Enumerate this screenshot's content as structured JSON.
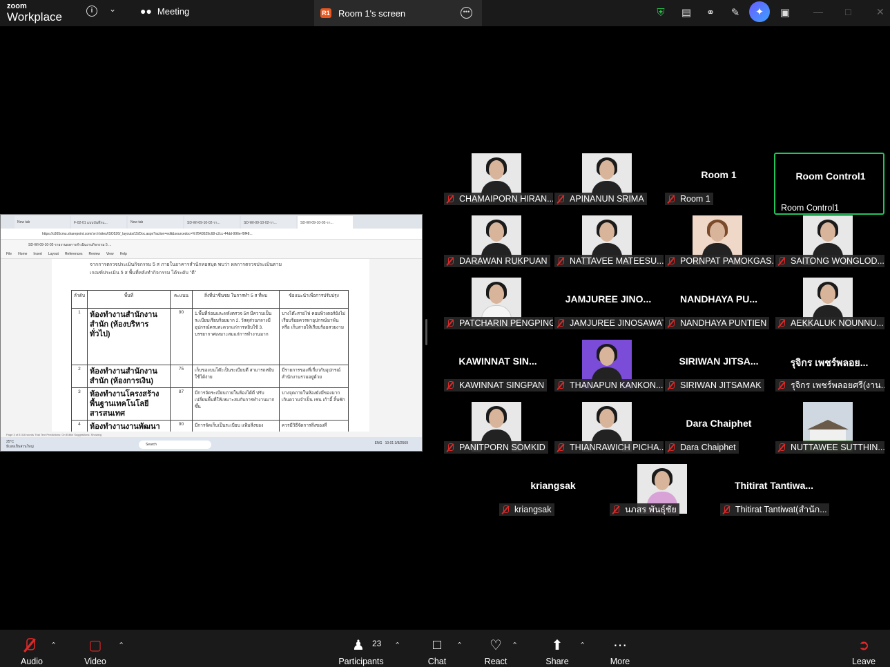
{
  "topbar": {
    "logo_small": "zoom",
    "logo_large": "Workplace",
    "meeting_label": "Meeting",
    "share_badge": "R1",
    "share_tab_label": "Room 1's screen"
  },
  "shared_screen": {
    "tabs": [
      "New tab",
      "F-02-01 แบบบันทึกแ...",
      "New tab",
      "SD-WI-09-10-02-รา...",
      "SD-WI-09-10-02-รา...",
      "SD-WI-09-10-02-รา..."
    ],
    "url": "https://o365cmu.sharepoint.com/:w:/r/sites/ISO526/_layouts/15/Doc.aspx?action=edit&sourcedoc=%7B43629c68-c2cc-44dd-996e-f9f48...",
    "doc_title": "SD-WI-09-10-02-รายงานผลการดำเนินงานกิจกรรม 5 ...",
    "menu": [
      "File",
      "Home",
      "Insert",
      "Layout",
      "References",
      "Review",
      "View",
      "Help"
    ],
    "intro_line1": "จากการตรวจประเมินกิจกรรม 5 ส ภายในอาคารสำนักหอสมุด พบว่า ผลการตรวจประเมินตาม",
    "intro_line2": "เกณฑ์ประเมิน 5 ส พื้นที่หลังทำกิจกรรม ได้ระดับ \"ดี\"",
    "headers": [
      "ลำดับ",
      "พื้นที่",
      "คะแนน",
      "สิ่งที่น่าชื่นชม ในการทำ 5 ส ที่พบ",
      "ข้อแนะนำเพื่อการปรับปรุง"
    ],
    "rows": [
      {
        "no": "1",
        "area": "ห้องทำงานสำนักงานสำนัก (ห้องบริหารทั่วไป)",
        "score": "90",
        "praise": "1.พื้นที่ก่อนและหลังตรวจ 5ส มีความเป็นระเบียบเรียบร้อยมาก 2. วัสดุส่วนกลางมีอุปกรณ์ครบสะดวกแก่การหยิบใช้ 3. บรรยากาศเหมาะสมแก่การทำงานมาก",
        "advice": "บางโต๊ะสายไฟ คอมพิวเตอร์ยังไม่เรียบร้อยควรหาอุปกรณ์มาพัน หรือ เก็บสายให้เรียบร้อยสวยงาม"
      },
      {
        "no": "2",
        "area": "ห้องทำงานสำนักงานสำนัก (ห้องการเงิน)",
        "score": "75",
        "praise": "เก็บของบนโต๊ะเป็นระเบียบดี สามารถหยิบใช้ได้ง่าย",
        "advice": "มีรายการของที่เกี่ยวกับอุปกรณ์สำนักงานรวมอยู่ด้วย"
      },
      {
        "no": "3",
        "area": "ห้องทำงานโครงสร้างพื้นฐานเทคโนโลยีสารสนเทศ",
        "score": "87",
        "praise": "มีการจัดระเบียบภายในห้องได้ดี ปรับเปลี่ยนพื้นที่ให้เหมาะสมกับการทำงานมากขึ้น",
        "advice": "บางจุดภายในห้องยังมีของมากเกินความจำเป็น เช่น เก้าอี้ ลิ้นชัก"
      },
      {
        "no": "4",
        "area": "ห้องทำงานงานพัฒนา",
        "score": "90",
        "praise": "มีการจัดเก็บเป็นระเบียบ แฟ้มสิ่งของ",
        "advice": "ควรมีวิธีจัดการสิ่งของที่"
      }
    ],
    "status_bar": "Page 3 of 8   316 words   Thai   Text Predictions: On   Editor Suggestions: Showing",
    "weather": "25°C",
    "weather_desc": "มีเมฆเป็นส่วนใหญ่",
    "search_placeholder": "Search",
    "clock_time": "10:01",
    "clock_date": "3/8/2569",
    "lang": "ENG"
  },
  "participants": [
    {
      "tag": "CHAMAIPORN HIRAN...",
      "photo": "dark"
    },
    {
      "tag": "APINANUN SRIMA",
      "photo": "dark"
    },
    {
      "tag": "Room 1",
      "big": "Room 1"
    },
    {
      "tag": "Room Control1",
      "big": "Room Control1",
      "active": true
    },
    {
      "tag": "DARAWAN RUKPUAN",
      "photo": "dark"
    },
    {
      "tag": "NATTAVEE MATEESU...",
      "photo": "dark"
    },
    {
      "tag": "PORNPAT PAMOKGAS...",
      "photo": "warm"
    },
    {
      "tag": "SAITONG WONGLOD...",
      "photo": "dark"
    },
    {
      "tag": "PATCHARIN PENGPING",
      "photo": "light"
    },
    {
      "tag": "JAMJUREE JINOSAWAT",
      "big": "JAMJUREE JINO..."
    },
    {
      "tag": "NANDHAYA PUNTIEN",
      "big": "NANDHAYA PU..."
    },
    {
      "tag": "AEKKALUK NOUNNU...",
      "photo": "dark"
    },
    {
      "tag": "KAWINNAT SINGPAN",
      "big": "KAWINNAT SIN..."
    },
    {
      "tag": "THANAPUN KANKON...",
      "photo": "purple"
    },
    {
      "tag": "SIRIWAN JITSAMAK",
      "big": "SIRIWAN JITSA..."
    },
    {
      "tag": "รุจิกร เพชร์พลอยศรี(งาน...",
      "big": "รุจิกร เพชร์พลอย..."
    },
    {
      "tag": "PANITPORN SOMKID",
      "photo": "dark"
    },
    {
      "tag": "THIANRAWICH PICHA...",
      "photo": "dark"
    },
    {
      "tag": "Dara Chaiphet",
      "big": "Dara Chaiphet"
    },
    {
      "tag": "NUTTAWEE SUTTHIN...",
      "photo": "build"
    },
    {
      "tag": "kriangsak",
      "big": "kriangsak"
    },
    {
      "tag": "นภสร พันธุ์ชัย",
      "photo": "pink"
    },
    {
      "tag": "Thitirat Tantiwat(สำนัก...",
      "big": "Thitirat  Tantiwa..."
    }
  ],
  "toolbar": {
    "audio": "Audio",
    "video": "Video",
    "participants": "Participants",
    "participant_count": "23",
    "chat": "Chat",
    "react": "React",
    "share": "Share",
    "more": "More",
    "leave": "Leave"
  },
  "colors": {
    "accent_green": "#22c55e",
    "muted_red": "#e02828",
    "share_badge": "#e9561f"
  }
}
